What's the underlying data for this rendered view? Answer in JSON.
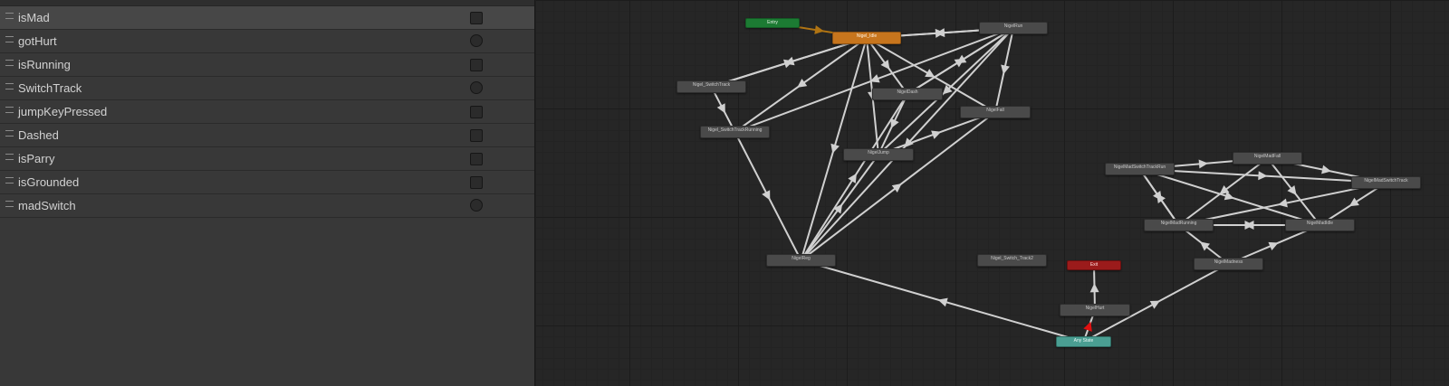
{
  "parameters": [
    {
      "name": "isMad",
      "type": "bool",
      "selected": true
    },
    {
      "name": "gotHurt",
      "type": "trigger"
    },
    {
      "name": "isRunning",
      "type": "bool"
    },
    {
      "name": "SwitchTrack",
      "type": "trigger"
    },
    {
      "name": "jumpKeyPressed",
      "type": "bool"
    },
    {
      "name": "Dashed",
      "type": "bool"
    },
    {
      "name": "isParry",
      "type": "bool"
    },
    {
      "name": "isGrounded",
      "type": "bool"
    },
    {
      "name": "madSwitch",
      "type": "trigger"
    }
  ],
  "states": {
    "entry": "Entry",
    "idle": "Nigel_Idle",
    "run": "NigelRun",
    "switch_track": "Nigel_SwitchTrack",
    "switch_track_running": "Nigel_SwitchTrackRunning",
    "dash": "NigelDash",
    "fall": "NigelFall",
    "jump": "NigelJump",
    "reg": "NigelReg",
    "switch_track2": "Nigel_Switch_Track2",
    "exit": "Exit",
    "hurt": "NigelHurt",
    "any_state": "Any State",
    "mad_switch_track_run": "NigelMadSwitchTrackRun",
    "mad_fall": "NigelMadFall",
    "mad_switch_track": "NigelMadSwitchTrack",
    "mad_running": "NigelMadRunning",
    "mad_idle": "NigelMadIdle",
    "madness": "NigelMadness"
  },
  "colors": {
    "entry": "#1c7b33",
    "default_state": "#c7751d",
    "exit": "#9b1b1b",
    "any_state": "#4a9e92",
    "state": "#4a4a4a",
    "transition": "#d0d0d0"
  }
}
